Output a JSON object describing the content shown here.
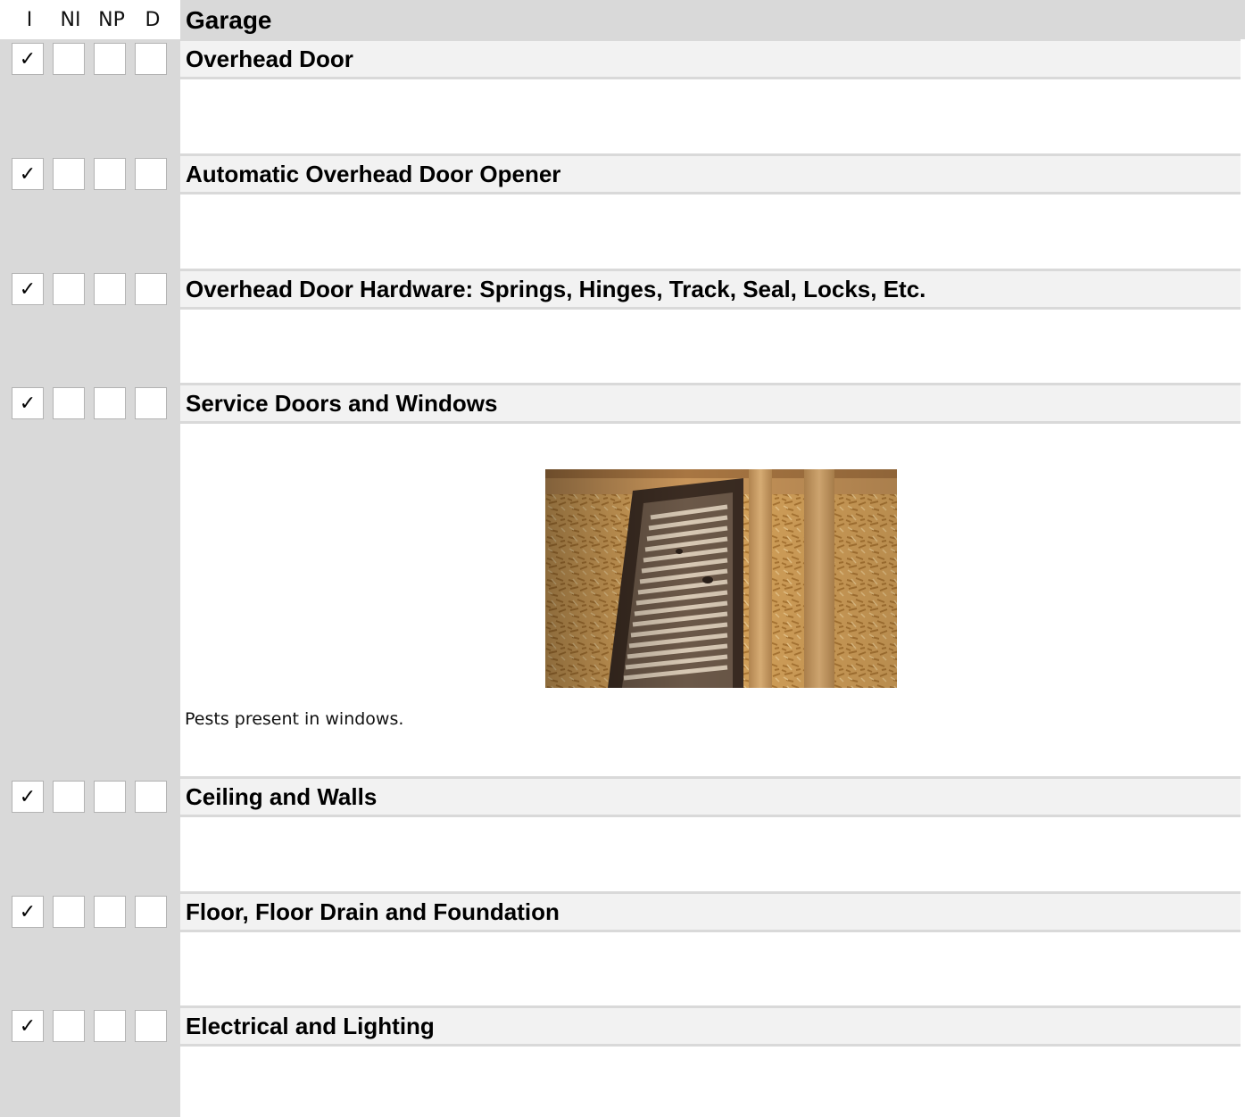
{
  "columns": [
    "I",
    "NI",
    "NP",
    "D"
  ],
  "section": {
    "title": "Garage"
  },
  "check_mark": "✓",
  "items": [
    {
      "title": "Overhead Door",
      "checks": [
        true,
        false,
        false,
        false
      ]
    },
    {
      "title": "Automatic Overhead Door Opener",
      "checks": [
        true,
        false,
        false,
        false
      ]
    },
    {
      "title": "Overhead Door Hardware: Springs, Hinges, Track, Seal, Locks, Etc.",
      "checks": [
        true,
        false,
        false,
        false
      ]
    },
    {
      "title": "Service Doors and Windows",
      "checks": [
        true,
        false,
        false,
        false
      ],
      "comment": "Pests present in windows."
    },
    {
      "title": "Ceiling and Walls",
      "checks": [
        true,
        false,
        false,
        false
      ]
    },
    {
      "title": "Floor, Floor Drain and Foundation",
      "checks": [
        true,
        false,
        false,
        false
      ]
    },
    {
      "title": "Electrical and Lighting",
      "checks": [
        true,
        false,
        false,
        false
      ]
    }
  ]
}
